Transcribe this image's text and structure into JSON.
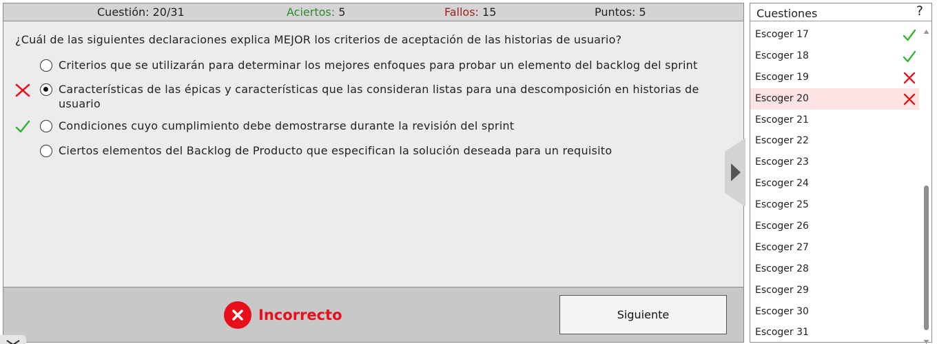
{
  "status": {
    "question_label": "Cuestión: 20/31",
    "correct_label": "Aciertos:",
    "correct_value": "5",
    "wrong_label": "Fallos:",
    "wrong_value": "15",
    "score_label": "Puntos: 5"
  },
  "question": {
    "text": "¿Cuál de las siguientes declaraciones explica MEJOR los criterios de aceptación de las historias de usuario?",
    "options": [
      {
        "text": "Criterios que se utilizarán para determinar los mejores enfoques para probar un elemento del backlog del sprint",
        "selected": false,
        "mark": ""
      },
      {
        "text": "Características de las épicas y características que las consideran listas para una descomposición en historias de usuario",
        "selected": true,
        "mark": "wrong"
      },
      {
        "text": "Condiciones cuyo cumplimiento debe demostrarse durante la revisión del sprint",
        "selected": false,
        "mark": "correct"
      },
      {
        "text": "Ciertos elementos del Backlog de Producto que especifican la solución deseada para un requisito",
        "selected": false,
        "mark": ""
      }
    ]
  },
  "result": {
    "text": "Incorrecto",
    "icon": "x-circle-icon",
    "color": "#e80f1a"
  },
  "next_button_label": "Siguiente",
  "question_list": {
    "title": "Cuestiones",
    "help_label": "?",
    "items": [
      {
        "label": "Escoger 17",
        "status": "correct"
      },
      {
        "label": "Escoger 18",
        "status": "correct"
      },
      {
        "label": "Escoger 19",
        "status": "wrong"
      },
      {
        "label": "Escoger 20",
        "status": "wrong",
        "current": true
      },
      {
        "label": "Escoger 21",
        "status": ""
      },
      {
        "label": "Escoger 22",
        "status": ""
      },
      {
        "label": "Escoger 23",
        "status": ""
      },
      {
        "label": "Escoger 24",
        "status": ""
      },
      {
        "label": "Escoger 25",
        "status": ""
      },
      {
        "label": "Escoger 26",
        "status": ""
      },
      {
        "label": "Escoger 27",
        "status": ""
      },
      {
        "label": "Escoger 28",
        "status": ""
      },
      {
        "label": "Escoger 29",
        "status": ""
      },
      {
        "label": "Escoger 30",
        "status": ""
      },
      {
        "label": "Escoger 31",
        "status": ""
      }
    ]
  },
  "colors": {
    "correct": "#2fb52f",
    "wrong": "#e8131c",
    "current_row_bg": "#fde3e3",
    "status_bar_bg": "#d4d4d4",
    "footer_bg": "#c8c8c8"
  }
}
